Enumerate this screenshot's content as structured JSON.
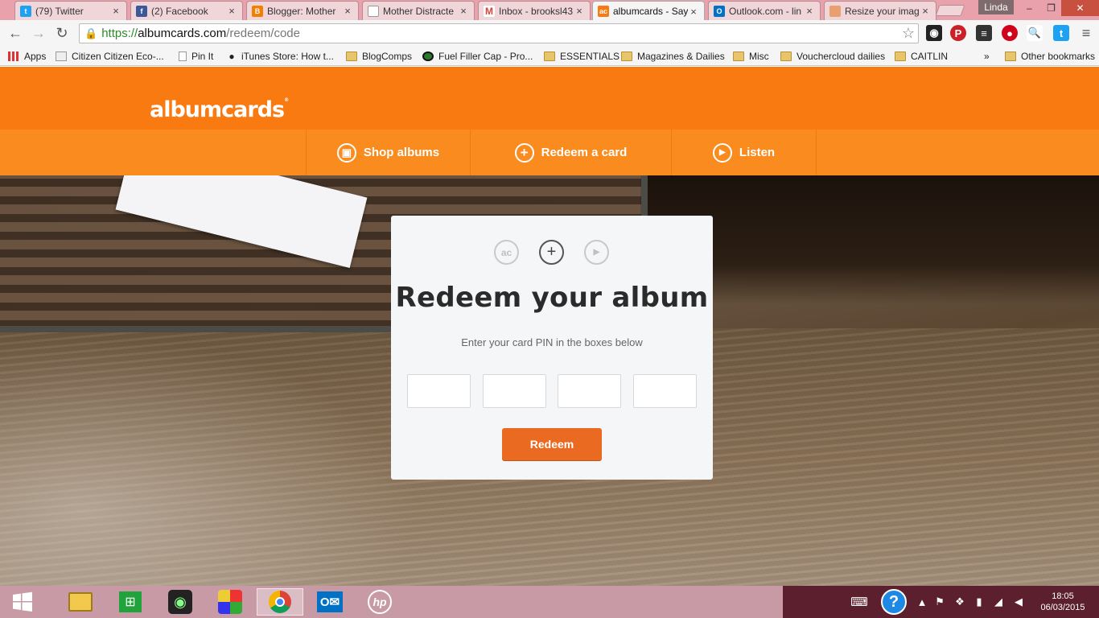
{
  "browser": {
    "tabs": [
      {
        "title": "(79) Twitter",
        "icon": "twitter-icon",
        "color": "#1da1f2"
      },
      {
        "title": "(2) Facebook",
        "icon": "facebook-icon",
        "color": "#3b5998"
      },
      {
        "title": "Blogger: Mother",
        "icon": "blogger-icon",
        "color": "#f57d00"
      },
      {
        "title": "Mother Distracte",
        "icon": "page-icon",
        "color": "#cccccc"
      },
      {
        "title": "Inbox - brooksl43",
        "icon": "gmail-icon",
        "color": "#d44638"
      },
      {
        "title": "albumcards - Say",
        "icon": "albumcards-icon",
        "color": "#f97a10",
        "favtext": "ac",
        "active": true
      },
      {
        "title": "Outlook.com - lin",
        "icon": "outlook-icon",
        "color": "#0072c6",
        "favtext": "O"
      },
      {
        "title": "Resize your imag",
        "icon": "resize-icon",
        "color": "#e8a070"
      }
    ],
    "user_name": "Linda",
    "url_scheme": "https://",
    "url_host": "albumcards.com",
    "url_path": "/redeem/code",
    "bookmarks": [
      {
        "label": "Apps",
        "icon": "apps-grid-icon"
      },
      {
        "label": "Citizen Citizen Eco-...",
        "icon": "citizen-icon"
      },
      {
        "label": "Pin It",
        "icon": "page-icon"
      },
      {
        "label": "iTunes Store: How t...",
        "icon": "apple-icon"
      },
      {
        "label": "BlogComps",
        "icon": "folder-icon"
      },
      {
        "label": "Fuel Filler Cap - Pro...",
        "icon": "fuel-icon"
      },
      {
        "label": "ESSENTIALS",
        "icon": "folder-icon"
      },
      {
        "label": "Magazines & Dailies",
        "icon": "folder-icon"
      },
      {
        "label": "Misc",
        "icon": "folder-icon"
      },
      {
        "label": "Vouchercloud dailies",
        "icon": "folder-icon"
      },
      {
        "label": "CAITLIN",
        "icon": "folder-icon"
      }
    ],
    "more_bookmarks": "»",
    "other_bookmarks": "Other bookmarks"
  },
  "site": {
    "logo": "albumcards",
    "logo_mark": "®",
    "brand_color": "#f97a10",
    "nav": [
      {
        "label": "Shop albums",
        "icon": "bag-icon"
      },
      {
        "label": "Redeem a card",
        "icon": "plus-circle-icon"
      },
      {
        "label": "Listen",
        "icon": "play-circle-icon"
      }
    ]
  },
  "redeem": {
    "steps": [
      {
        "label": "ac",
        "icon": "albumcards-step-icon"
      },
      {
        "label": "+",
        "icon": "plus-step-icon"
      },
      {
        "label": "▶",
        "icon": "play-step-icon"
      }
    ],
    "title": "Redeem your album",
    "subtitle": "Enter your card PIN in the boxes below",
    "pin_values": [
      "",
      "",
      "",
      ""
    ],
    "button": "Redeem"
  },
  "taskbar": {
    "time": "18:05",
    "date": "06/03/2015"
  }
}
